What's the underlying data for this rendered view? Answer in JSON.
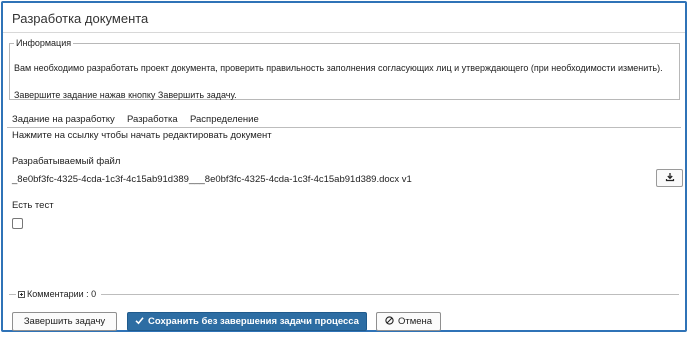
{
  "dialog": {
    "title": "Разработка документа"
  },
  "info": {
    "legend": "Информация",
    "text1": "Вам необходимо разработать проект документа, проверить правильность заполнения согласующих лиц и утверждающего (при необходимости изменить).",
    "text2": "Завершите задание нажав кнопку Завершить задачу."
  },
  "tabs": [
    {
      "label": "Задание на разработку"
    },
    {
      "label": "Разработка"
    },
    {
      "label": "Распределение"
    }
  ],
  "tab_hint": "Нажмите на ссылку чтобы начать редактировать документ",
  "file": {
    "label": "Разрабатываемый файл",
    "name": "_8e0bf3fc-4325-4cda-1c3f-4c15ab91d389___8e0bf3fc-4325-4cda-1c3f-4c15ab91d389.docx  v1",
    "download_icon": "download-icon"
  },
  "test": {
    "label": "Есть тест",
    "checked": false
  },
  "comments": {
    "label": "Комментарии : 0"
  },
  "buttons": {
    "finish": "Завершить задачу",
    "save": "Сохранить без завершения задачи процесса",
    "cancel": "Отмена"
  },
  "colors": {
    "accent": "#2f73b7",
    "primary_button": "#2d6da3"
  }
}
